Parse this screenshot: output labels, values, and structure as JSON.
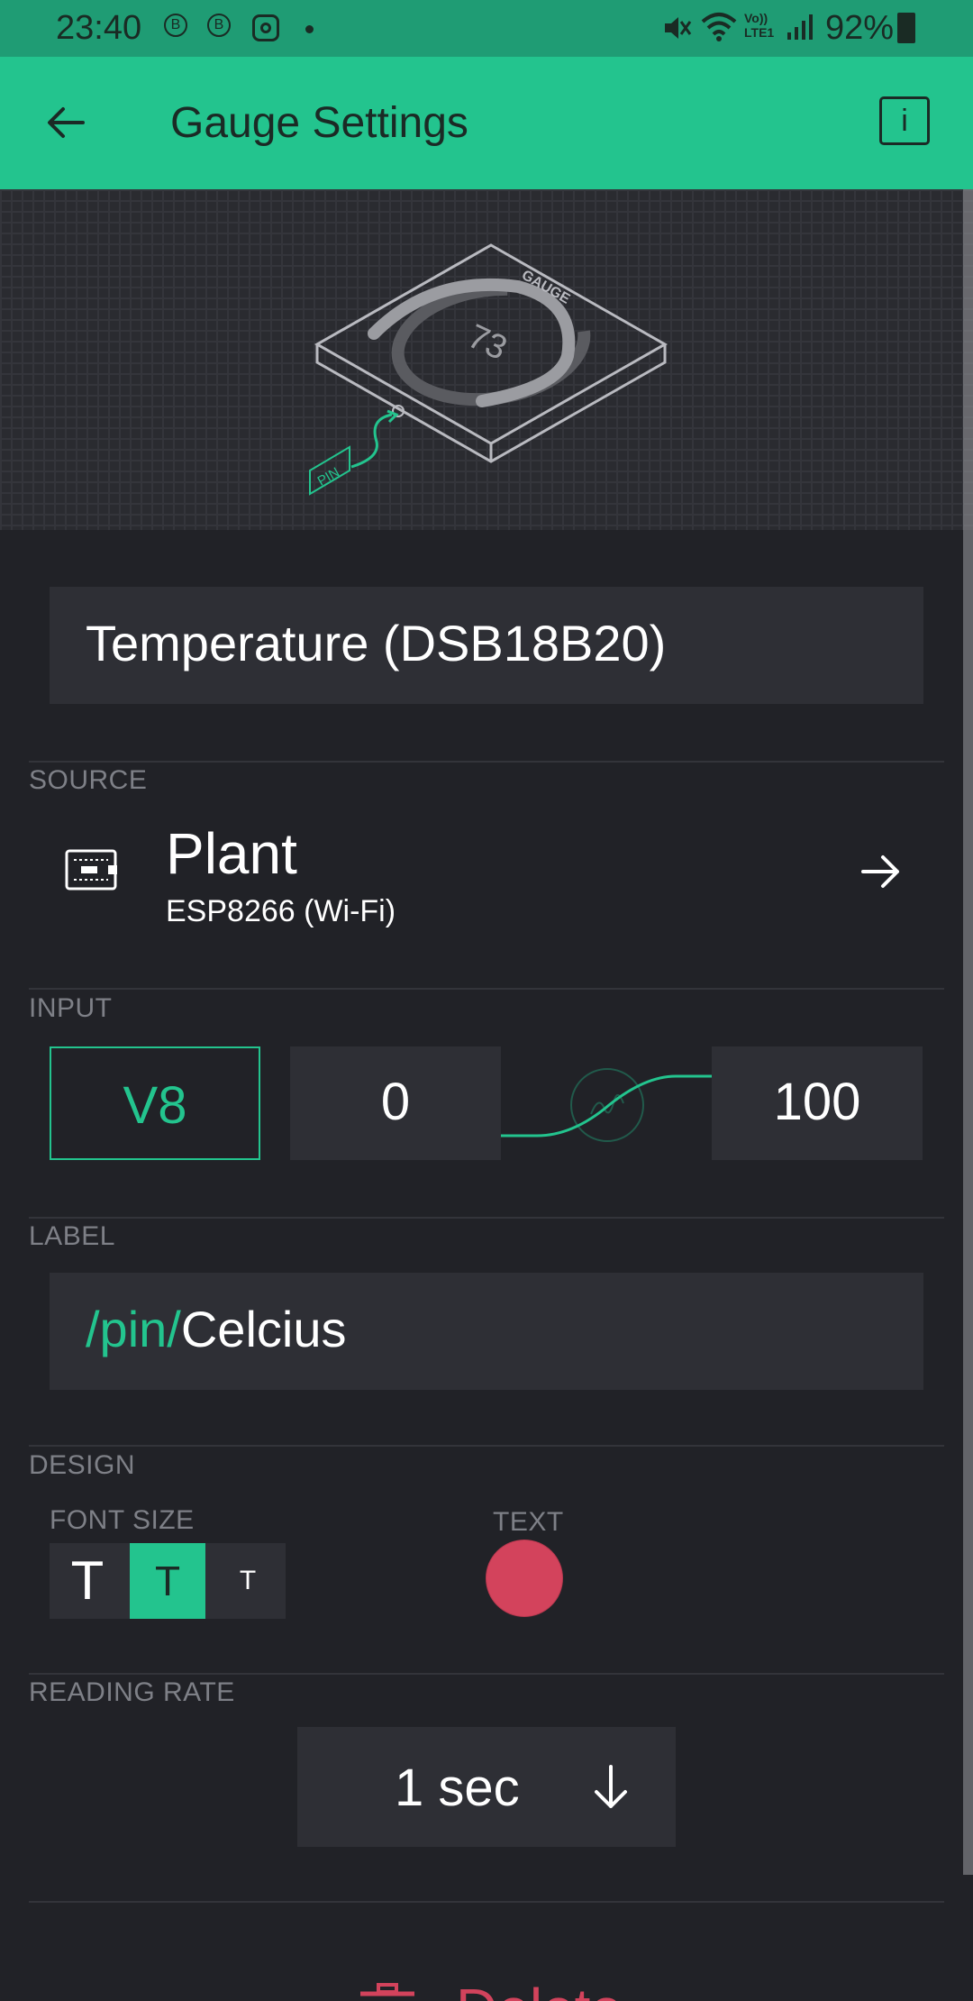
{
  "status_bar": {
    "time": "23:40",
    "left_icons": [
      "b-circle-icon",
      "b-circle-icon",
      "instagram-icon",
      "dot-icon"
    ],
    "right_icons": [
      "mute-icon",
      "wifi-icon",
      "volte-icon",
      "signal-icon"
    ],
    "volte_label": "Vo)) LTE1",
    "battery_percent": "92%"
  },
  "app_bar": {
    "title": "Gauge Settings",
    "info_label": "i"
  },
  "preview": {
    "gauge_label": "GAUGE",
    "gauge_value": "73",
    "pin_label": "PIN",
    "gauge_fill": 0.73
  },
  "widget_name": "Temperature (DSB18B20)",
  "source": {
    "section": "SOURCE",
    "device_name": "Plant",
    "device_type": "ESP8266 (Wi-Fi)"
  },
  "input": {
    "section": "INPUT",
    "pin": "V8",
    "min": "0",
    "max": "100"
  },
  "label": {
    "section": "LABEL",
    "prefix": "/pin/",
    "text": "Celcius"
  },
  "design": {
    "section": "DESIGN",
    "font_size_label": "FONT SIZE",
    "font_options": [
      "T",
      "T",
      "T"
    ],
    "selected_font_index": 1,
    "text_color_label": "TEXT",
    "text_color": "#d3435c"
  },
  "reading_rate": {
    "section": "READING RATE",
    "value": "1 sec"
  },
  "delete": {
    "label": "Delete"
  },
  "colors": {
    "accent": "#23c48e",
    "status_bar": "#1f9c74",
    "background": "#212227",
    "field": "#2e2f35",
    "danger": "#d3435c"
  }
}
